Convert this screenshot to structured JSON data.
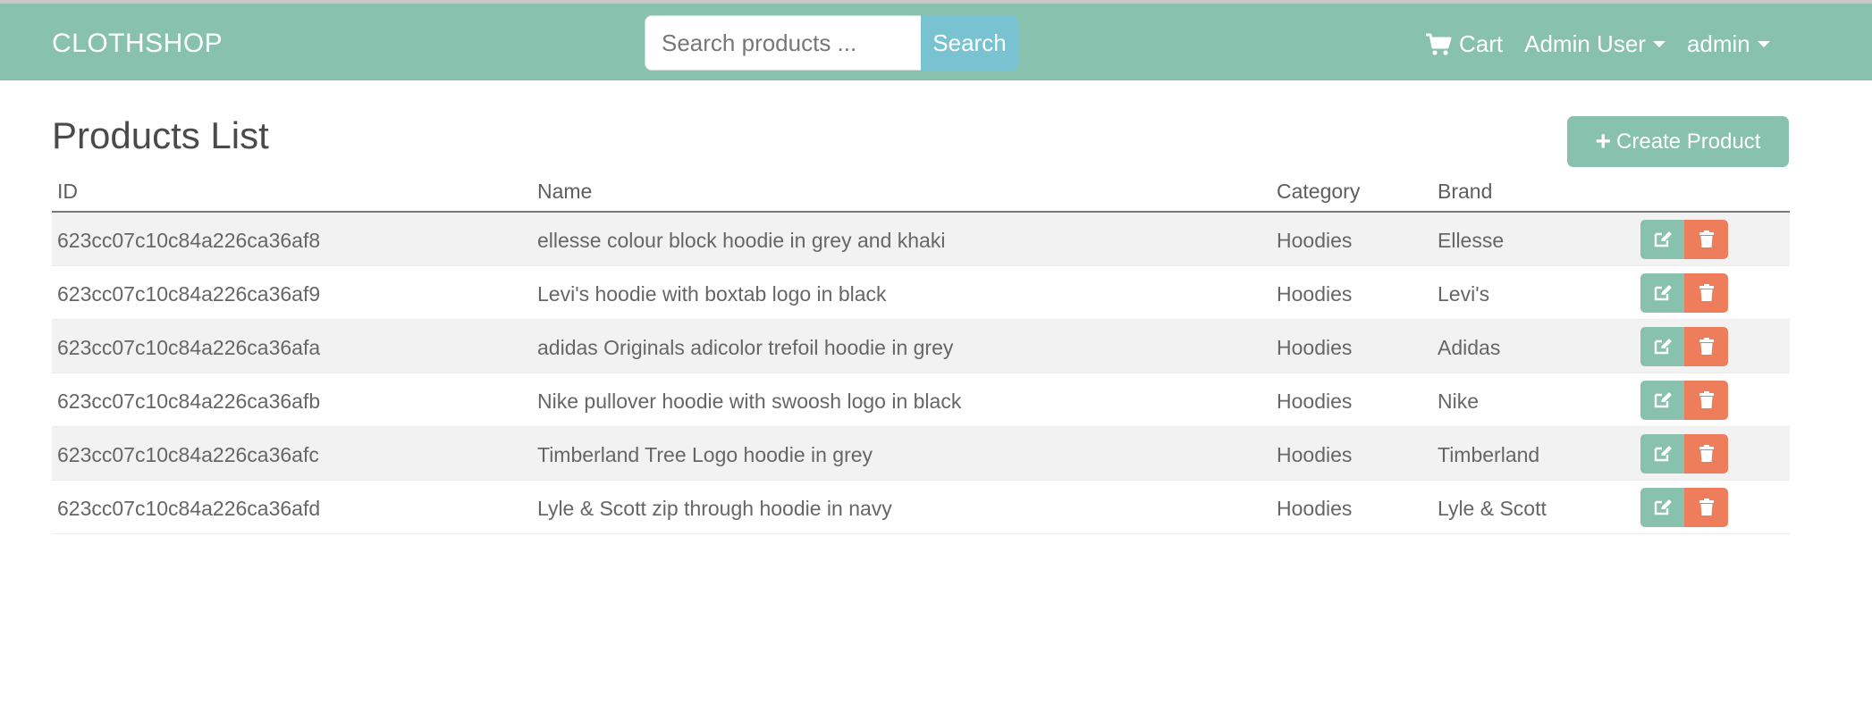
{
  "navbar": {
    "brand": "CLOTHSHOP",
    "search_placeholder": "Search products ...",
    "search_button": "Search",
    "cart_label": "Cart",
    "user_menu": "Admin User",
    "admin_menu": "admin",
    "bg_color": "#88c1ad"
  },
  "page": {
    "title": "Products List",
    "create_button": "Create Product"
  },
  "table": {
    "headers": [
      "ID",
      "Name",
      "Category",
      "Brand"
    ],
    "rows": [
      {
        "id": "623cc07c10c84a226ca36af8",
        "name": "ellesse colour block hoodie in grey and khaki",
        "category": "Hoodies",
        "brand": "Ellesse"
      },
      {
        "id": "623cc07c10c84a226ca36af9",
        "name": "Levi's hoodie with boxtab logo in black",
        "category": "Hoodies",
        "brand": "Levi's"
      },
      {
        "id": "623cc07c10c84a226ca36afa",
        "name": "adidas Originals adicolor trefoil hoodie in grey",
        "category": "Hoodies",
        "brand": "Adidas"
      },
      {
        "id": "623cc07c10c84a226ca36afb",
        "name": "Nike pullover hoodie with swoosh logo in black",
        "category": "Hoodies",
        "brand": "Nike"
      },
      {
        "id": "623cc07c10c84a226ca36afc",
        "name": "Timberland Tree Logo hoodie in grey",
        "category": "Hoodies",
        "brand": "Timberland"
      },
      {
        "id": "623cc07c10c84a226ca36afd",
        "name": "Lyle & Scott zip through hoodie in navy",
        "category": "Hoodies",
        "brand": "Lyle & Scott"
      }
    ],
    "edit_color": "#88c1ad",
    "delete_color": "#ee7e5b"
  }
}
